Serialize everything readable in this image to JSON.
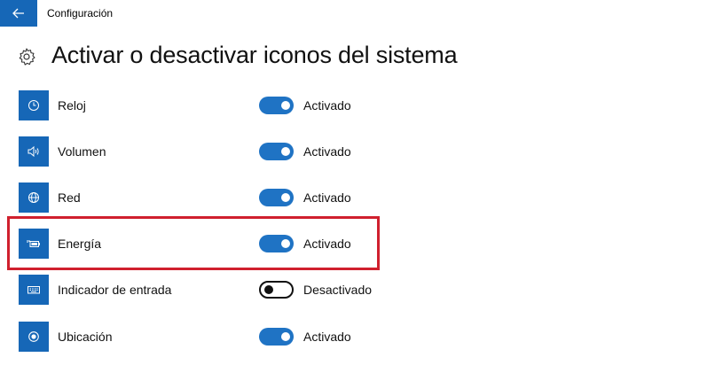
{
  "window": {
    "title": "Configuración"
  },
  "header": {
    "title": "Activar o desactivar iconos del sistema"
  },
  "items": [
    {
      "label": "Reloj",
      "state": "Activado",
      "on": true,
      "icon": "clock-icon"
    },
    {
      "label": "Volumen",
      "state": "Activado",
      "on": true,
      "icon": "volume-icon"
    },
    {
      "label": "Red",
      "state": "Activado",
      "on": true,
      "icon": "network-icon"
    },
    {
      "label": "Energía",
      "state": "Activado",
      "on": true,
      "icon": "battery-icon"
    },
    {
      "label": "Indicador de entrada",
      "state": "Desactivado",
      "on": false,
      "icon": "keyboard-icon"
    },
    {
      "label": "Ubicación",
      "state": "Activado",
      "on": true,
      "icon": "location-icon"
    }
  ],
  "colors": {
    "accent": "#1667b7",
    "highlight": "#d0202e"
  }
}
